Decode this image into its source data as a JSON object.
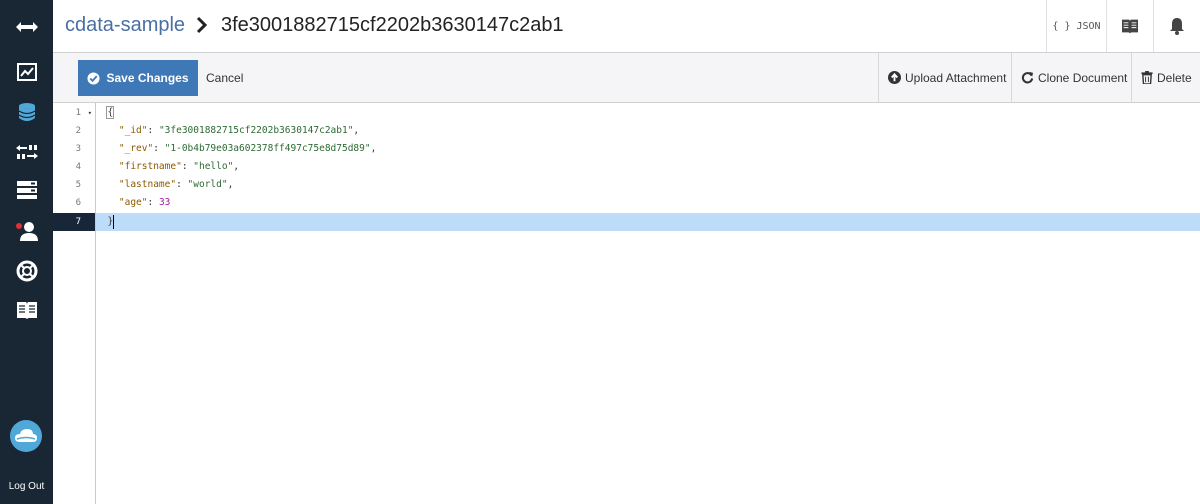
{
  "sidebar": {
    "icons": [
      "expand-arrows-icon",
      "activity-chart-icon",
      "database-icon",
      "replication-icon",
      "server-icon",
      "user-notification-icon",
      "support-lifebuoy-icon",
      "documentation-book-icon"
    ],
    "logout_label": "Log Out"
  },
  "header": {
    "database": "cdata-sample",
    "document_id": "3fe3001882715cf2202b3630147c2ab1",
    "json_label": "{ } JSON"
  },
  "toolbar": {
    "save_label": "Save Changes",
    "cancel_label": "Cancel",
    "upload_label": "Upload Attachment",
    "clone_label": "Clone Document",
    "delete_label": "Delete"
  },
  "editor": {
    "line_numbers": [
      "1",
      "2",
      "3",
      "4",
      "5",
      "6",
      "7"
    ],
    "fold_marker": "▾",
    "lines": [
      {
        "open": "{"
      },
      {
        "key": "\"_id\"",
        "value": "\"3fe3001882715cf2202b3630147c2ab1\""
      },
      {
        "key": "\"_rev\"",
        "value": "\"1-0b4b79e03a602378ff497c75e8d75d89\""
      },
      {
        "key": "\"firstname\"",
        "value": "\"hello\""
      },
      {
        "key": "\"lastname\"",
        "value": "\"world\""
      },
      {
        "key": "\"age\"",
        "value": "33"
      },
      {
        "close": "}"
      }
    ]
  },
  "colors": {
    "sidebar_bg": "#182733",
    "primary_button": "#3f78b7",
    "active_line": "#bcdcfa"
  }
}
